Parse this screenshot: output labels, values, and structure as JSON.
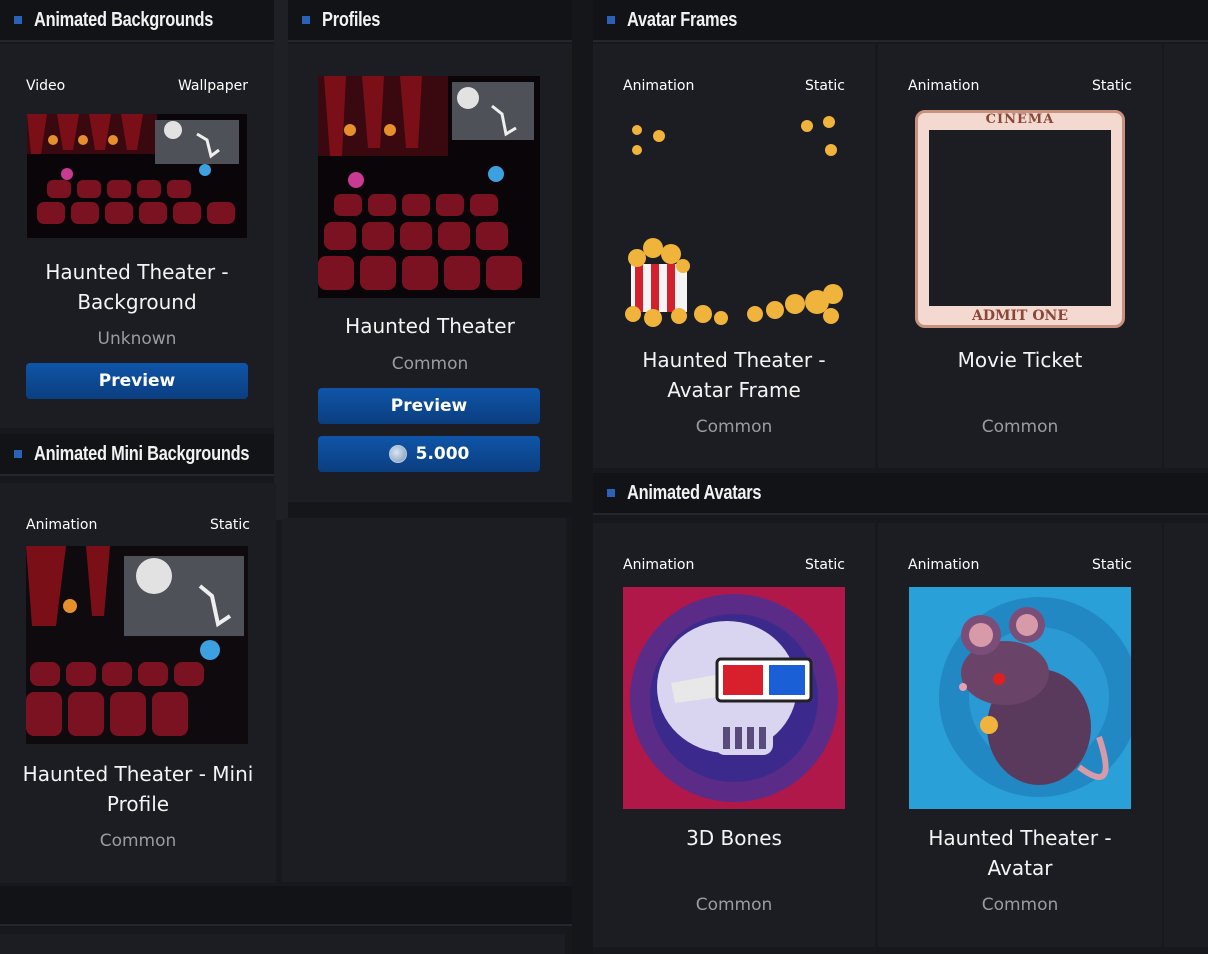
{
  "sections": {
    "animated_backgrounds": "Animated Backgrounds",
    "profiles": "Profiles",
    "avatar_frames": "Avatar Frames",
    "animated_mini_backgrounds": "Animated Mini Backgrounds",
    "animated_avatars": "Animated Avatars"
  },
  "cards": {
    "background": {
      "tag_left": "Video",
      "tag_right": "Wallpaper",
      "name_line1": "Haunted Theater -",
      "name_line2": "Background",
      "rarity": "Unknown",
      "button": "Preview"
    },
    "profile": {
      "name": "Haunted Theater",
      "rarity": "Common",
      "button": "Preview",
      "price": "5.000"
    },
    "mini_profile": {
      "tag_left": "Animation",
      "tag_right": "Static",
      "name_line1": "Haunted Theater - Mini",
      "name_line2": "Profile",
      "rarity": "Common"
    },
    "frame_1": {
      "tag_left": "Animation",
      "tag_right": "Static",
      "name_line1": "Haunted Theater -",
      "name_line2": "Avatar Frame",
      "rarity": "Common"
    },
    "frame_2": {
      "tag_left": "Animation",
      "tag_right": "Static",
      "name": "Movie Ticket",
      "rarity": "Common",
      "ticket_top": "CINEMA",
      "ticket_bottom": "ADMIT ONE"
    },
    "avatar_1": {
      "tag_left": "Animation",
      "tag_right": "Static",
      "name": "3D Bones",
      "rarity": "Common"
    },
    "avatar_2": {
      "tag_left": "Animation",
      "tag_right": "Static",
      "name_line1": "Haunted Theater -",
      "name_line2": "Avatar",
      "rarity": "Common"
    }
  },
  "colors": {
    "accent": "#2b62b8",
    "button": "#0f55a8",
    "background": "#16181d"
  }
}
